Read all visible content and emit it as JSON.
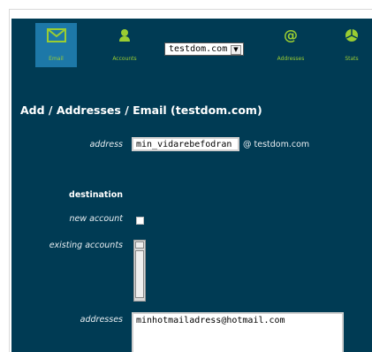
{
  "nav": {
    "items": [
      {
        "label": "Email",
        "icon": "envelope-icon",
        "active": true
      },
      {
        "label": "Accounts",
        "icon": "user-icon",
        "active": false
      },
      {
        "label": "Addresses",
        "icon": "at-icon",
        "active": false
      },
      {
        "label": "Stats",
        "icon": "pie-chart-icon",
        "active": false
      }
    ],
    "domain_select": "testdom.com"
  },
  "page": {
    "title": "Add / Addresses / Email (testdom.com)"
  },
  "form": {
    "address_label": "address",
    "address_value": "min_vidarebefodran",
    "at_domain": "@ testdom.com",
    "destination_heading": "destination",
    "new_account_label": "new account",
    "existing_accounts_label": "existing accounts",
    "addresses_label": "addresses",
    "addresses_value": "minhotmailadress@hotmail.com"
  },
  "colors": {
    "panel_bg": "#003b54",
    "active_tab": "#1d78a8",
    "icon_green": "#9acd32"
  }
}
